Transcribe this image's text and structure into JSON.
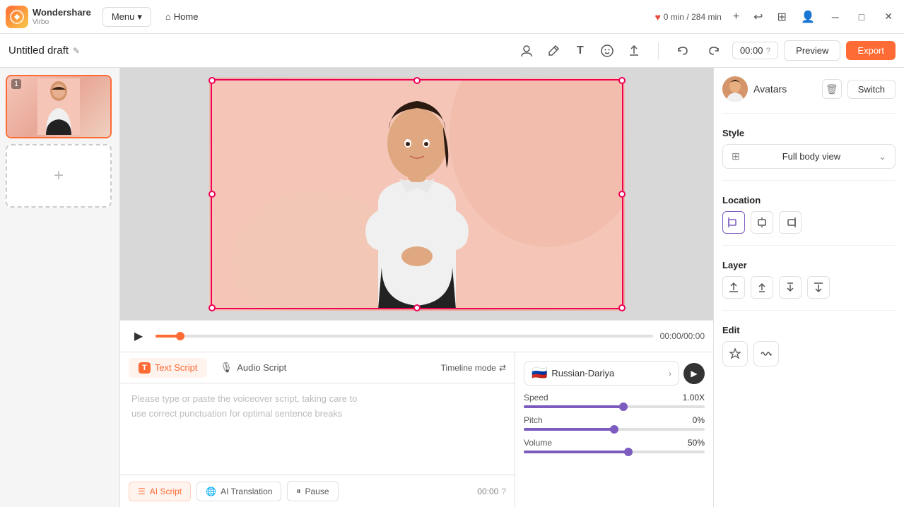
{
  "app": {
    "logo_top": "Wondershare",
    "logo_bottom": "Virbo"
  },
  "topbar": {
    "menu_label": "Menu",
    "home_label": "Home",
    "credits": "0 min / 284 min",
    "add_icon": "+",
    "history_icon": "↩",
    "layout_icon": "⊞",
    "account_icon": "👤",
    "minimize": "─",
    "maximize": "□",
    "close": "✕"
  },
  "toolbar": {
    "file_title": "Untitled draft",
    "edit_icon": "✎",
    "avatar_tool": "👤",
    "brush_tool": "✏",
    "text_tool": "T",
    "emoji_tool": "😊",
    "upload_tool": "⬆",
    "undo_icon": "↩",
    "redo_icon": "↪",
    "timer": "00:00",
    "preview_label": "Preview",
    "export_label": "Export"
  },
  "slides": {
    "items": [
      {
        "number": "1",
        "active": true
      }
    ],
    "add_label": "+"
  },
  "canvas": {
    "time_display": "00:00/00:00"
  },
  "script": {
    "text_tab": "Text Script",
    "audio_tab": "Audio Script",
    "timeline_mode": "Timeline mode",
    "placeholder_line1": "Please type or paste the voiceover script, taking care to",
    "placeholder_line2": "use correct punctuation for optimal sentence breaks",
    "ai_script_label": "AI Script",
    "ai_translation_label": "AI Translation",
    "pause_label": "Pause",
    "timer": "00:00"
  },
  "voice": {
    "language": "Russian-Dariya",
    "flag": "🇷🇺",
    "speed_label": "Speed",
    "speed_value": "1.00X",
    "speed_pct": 55,
    "pitch_label": "Pitch",
    "pitch_value": "0%",
    "pitch_pct": 50,
    "volume_label": "Volume",
    "volume_value": "50%",
    "volume_pct": 58
  },
  "right_panel": {
    "avatar_label": "Avatars",
    "switch_label": "Switch",
    "style_section": "Style",
    "style_option": "Full body view",
    "location_section": "Location",
    "layer_section": "Layer",
    "edit_section": "Edit"
  },
  "icons": {
    "play": "▶",
    "chevron_right": "›",
    "chevron_down": "⌄",
    "align_left": "⬛",
    "align_center": "⬛",
    "align_right": "⬛",
    "layer_up_most": "⬆",
    "layer_up": "↑",
    "layer_down": "↓",
    "layer_down_most": "⬇",
    "edit_crop": "⬡",
    "edit_wave": "≈"
  }
}
